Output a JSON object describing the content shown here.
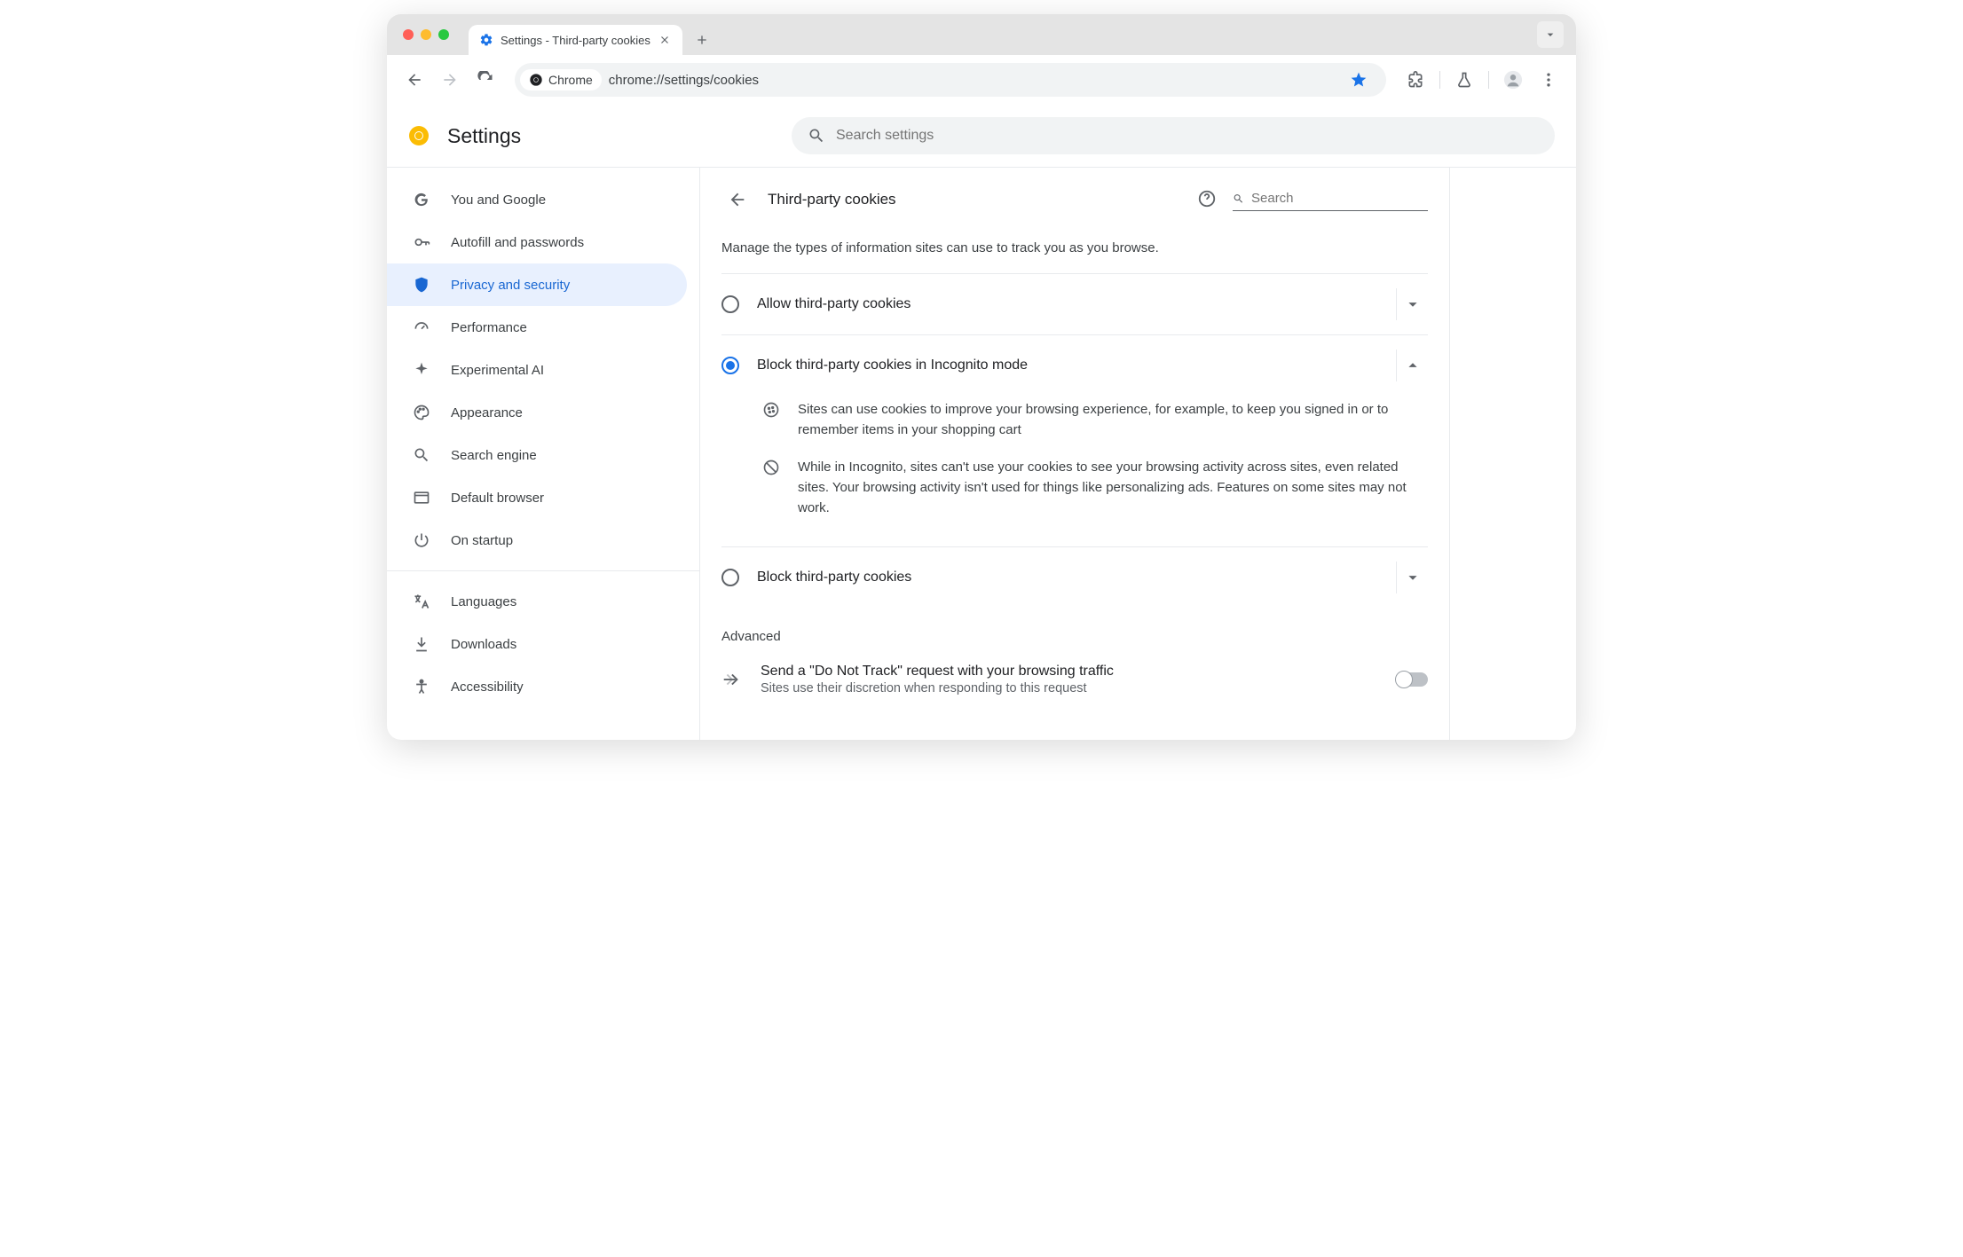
{
  "browser": {
    "tab_title": "Settings - Third-party cookies",
    "omnibox_label": "Chrome",
    "url": "chrome://settings/cookies"
  },
  "header": {
    "app_title": "Settings",
    "search_placeholder": "Search settings"
  },
  "sidebar": {
    "items": [
      {
        "label": "You and Google"
      },
      {
        "label": "Autofill and passwords"
      },
      {
        "label": "Privacy and security"
      },
      {
        "label": "Performance"
      },
      {
        "label": "Experimental AI"
      },
      {
        "label": "Appearance"
      },
      {
        "label": "Search engine"
      },
      {
        "label": "Default browser"
      },
      {
        "label": "On startup"
      }
    ],
    "group2": [
      {
        "label": "Languages"
      },
      {
        "label": "Downloads"
      },
      {
        "label": "Accessibility"
      }
    ]
  },
  "content": {
    "title": "Third-party cookies",
    "search_placeholder": "Search",
    "intro": "Manage the types of information sites can use to track you as you browse.",
    "options": [
      {
        "label": "Allow third-party cookies",
        "selected": false,
        "expanded": false
      },
      {
        "label": "Block third-party cookies in Incognito mode",
        "selected": true,
        "expanded": true,
        "details": [
          "Sites can use cookies to improve your browsing experience, for example, to keep you signed in or to remember items in your shopping cart",
          "While in Incognito, sites can't use your cookies to see your browsing activity across sites, even related sites. Your browsing activity isn't used for things like personalizing ads. Features on some sites may not work."
        ]
      },
      {
        "label": "Block third-party cookies",
        "selected": false,
        "expanded": false
      }
    ],
    "advanced_heading": "Advanced",
    "dnt": {
      "title": "Send a \"Do Not Track\" request with your browsing traffic",
      "subtitle": "Sites use their discretion when responding to this request",
      "enabled": false
    }
  }
}
